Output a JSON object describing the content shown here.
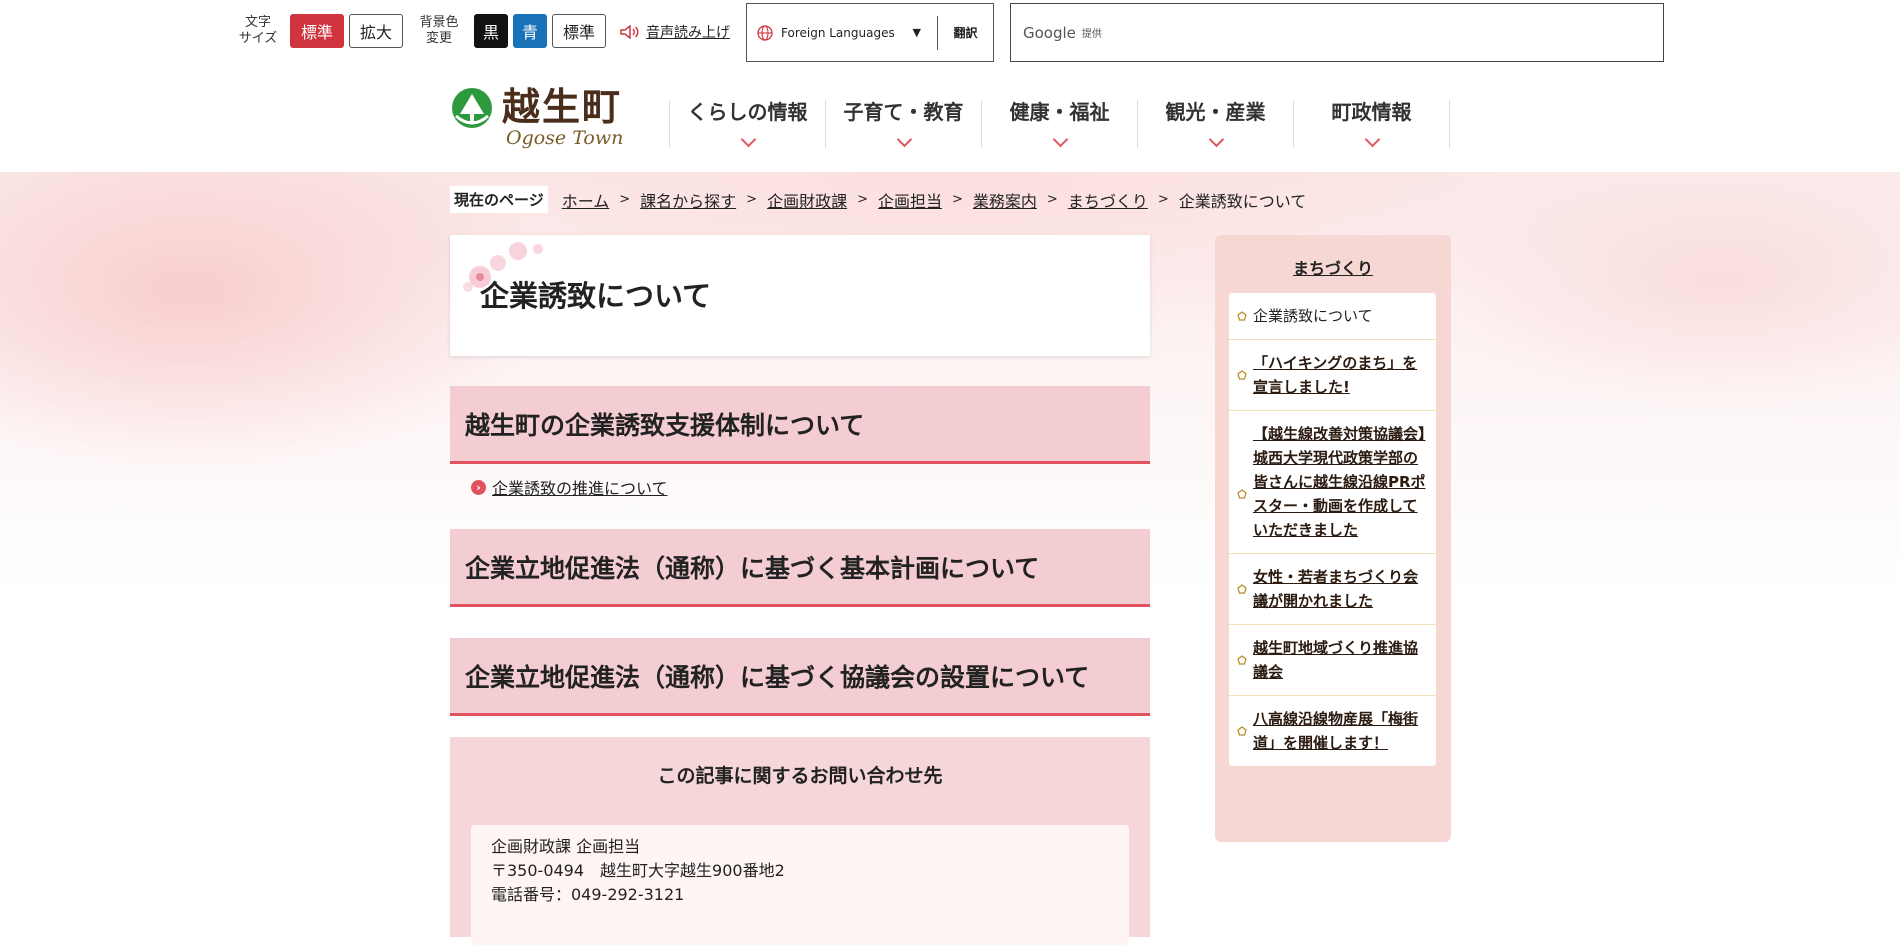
{
  "topbar": {
    "font_size_label": "文字\nサイズ",
    "font_standard": "標準",
    "font_large": "拡大",
    "bg_color_label": "背景色\n変更",
    "bg_black": "黒",
    "bg_blue": "青",
    "bg_standard": "標準",
    "voice_label": "音声読み上げ",
    "language_select": "Foreign Languages",
    "translate_button": "翻訳",
    "search_brand": "Google",
    "search_provided": "提供"
  },
  "header": {
    "logo_jp": "越生町",
    "logo_en": "Ogose Town",
    "nav": [
      {
        "label": "くらしの情報"
      },
      {
        "label": "子育て・教育"
      },
      {
        "label": "健康・福祉"
      },
      {
        "label": "観光・産業"
      },
      {
        "label": "町政情報"
      }
    ]
  },
  "breadcrumb": {
    "here": "現在のページ",
    "items": [
      "ホーム",
      "課名から探す",
      "企画財政課",
      "企画担当",
      "業務案内",
      "まちづくり"
    ],
    "current": "企業誘致について"
  },
  "main": {
    "title": "企業誘致について",
    "sections": [
      {
        "heading": "越生町の企業誘致支援体制について",
        "link": "企業誘致の推進について"
      },
      {
        "heading": "企業立地促進法（通称）に基づく基本計画について"
      },
      {
        "heading": "企業立地促進法（通称）に基づく協議会の設置について"
      }
    ],
    "contact": {
      "heading": "この記事に関するお問い合わせ先",
      "line1": "企画財政課 企画担当",
      "line2": "〒350-0494　越生町大字越生900番地2",
      "line3": "電話番号：049-292-3121"
    }
  },
  "sidebar": {
    "title": "まちづくり",
    "items": [
      "企業誘致について",
      "「ハイキングのまち」を宣言しました!",
      "【越生線改善対策協議会】城西大学現代政策学部の皆さんに越生線沿線PRポスター・動画を作成していただきました",
      "女性・若者まちづくり会議が開かれました",
      "越生町地域づくり推進協議会",
      "八高線沿線物産展「梅街道」を開催します！"
    ]
  },
  "colors": {
    "accent_red": "#d0343e",
    "section_bg": "#f3cdd1",
    "section_border": "#e0535e",
    "bg_blue": "#1a73b8"
  }
}
